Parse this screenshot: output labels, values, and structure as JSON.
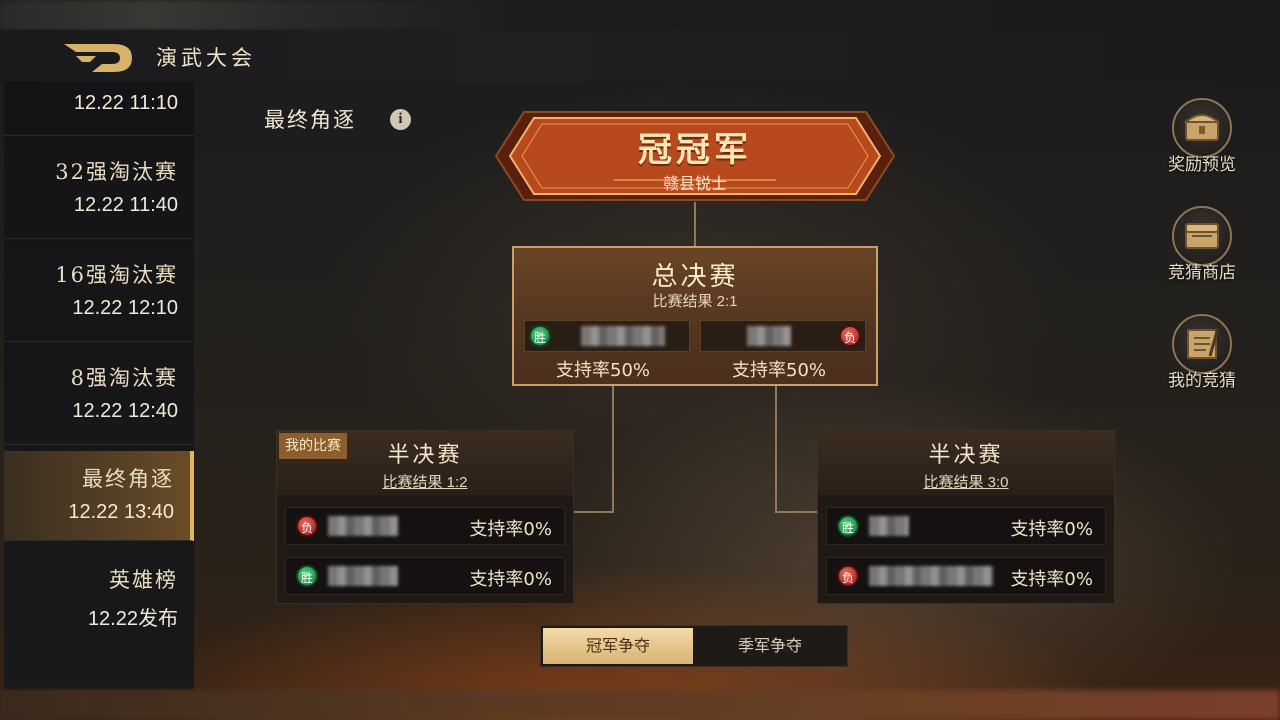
{
  "header": {
    "title": "演武大会"
  },
  "sidebar": {
    "items": [
      {
        "name": "",
        "time": "12.22 11:10",
        "active": false
      },
      {
        "name": "32强淘汰赛",
        "time": "12.22 11:40",
        "active": false
      },
      {
        "name": "16强淘汰赛",
        "time": "12.22 12:10",
        "active": false
      },
      {
        "name": "8强淘汰赛",
        "time": "12.22 12:40",
        "active": false
      },
      {
        "name": "最终角逐",
        "time": "12.22 13:40",
        "active": true
      },
      {
        "name": "英雄榜",
        "time": "12.22发布",
        "active": false
      }
    ]
  },
  "section": {
    "title": "最终角逐",
    "info_icon": "info-icon"
  },
  "champion": {
    "title": "冠冠军",
    "team": "赣县锐士"
  },
  "final": {
    "title": "总决赛",
    "result": "比赛结果 2:1",
    "left": {
      "badge": "胜",
      "support": "支持率50%"
    },
    "right": {
      "badge": "负",
      "support": "支持率50%"
    }
  },
  "semis": [
    {
      "title": "半决赛",
      "result": "比赛结果 1:2",
      "tag": "我的比赛",
      "rows": [
        {
          "badge": "负",
          "support": "支持率0%"
        },
        {
          "badge": "胜",
          "support": "支持率0%"
        }
      ]
    },
    {
      "title": "半决赛",
      "result": "比赛结果 3:0",
      "tag": "",
      "rows": [
        {
          "badge": "胜",
          "support": "支持率0%"
        },
        {
          "badge": "负",
          "support": "支持率0%"
        }
      ]
    }
  ],
  "tabs": {
    "active": "冠军争夺",
    "inactive": "季军争夺"
  },
  "side_buttons": [
    {
      "label": "奖励预览",
      "icon": "chest-icon"
    },
    {
      "label": "竞猜商店",
      "icon": "shop-chest-icon"
    },
    {
      "label": "我的竞猜",
      "icon": "scroll-icon"
    }
  ],
  "colors": {
    "gold": "#e0b566",
    "win": "#1f9a4a",
    "lose": "#b5271e",
    "panel_border": "#c9a06a"
  }
}
